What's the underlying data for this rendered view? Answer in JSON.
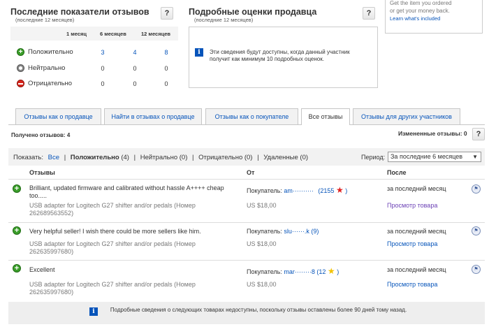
{
  "left_panel": {
    "title": "Последние показатели отзывов",
    "subtitle": "(последние 12 месяцев)",
    "help": "?",
    "columns": [
      "1 месяц",
      "6 месяцев",
      "12 месяцев"
    ],
    "rows": [
      {
        "label": "Положительно",
        "values": [
          "3",
          "4",
          "8"
        ]
      },
      {
        "label": "Нейтрально",
        "values": [
          "0",
          "0",
          "0"
        ]
      },
      {
        "label": "Отрицательно",
        "values": [
          "0",
          "0",
          "0"
        ]
      }
    ]
  },
  "mid_panel": {
    "title": "Подробные оценки продавца",
    "subtitle": "(последние 12 месяцев)",
    "help": "?",
    "info": "Эти сведения будут доступны, когда данный участник получит как минимум 10 подробных оценок.",
    "info_icon": "i"
  },
  "right_panel": {
    "line1": "Get the item you ordered",
    "line2": "or get your money back.",
    "link": "Learn what's included"
  },
  "tabs": [
    "Отзывы как о продавце",
    "Найти в отзывах о продавце",
    "Отзывы как о покупателе",
    "Все отзывы",
    "Отзывы для других участников"
  ],
  "received": "Получено отзывов: 4",
  "changed": "Измененные отзывы: 0",
  "changed_help": "?",
  "filter": {
    "show_label": "Показать:",
    "all": "Все",
    "positive": "Положительно",
    "positive_count": "(4)",
    "neutral": "Нейтрально (0)",
    "negative": "Отрицательно (0)",
    "deleted": "Удаленные (0)",
    "separator": "|",
    "period_label": "Период:",
    "period_value": "За последние 6 месяцев"
  },
  "table": {
    "col_reviews": "Отзывы",
    "col_from": "От",
    "col_when": "После",
    "rows": [
      {
        "comment": "Brilliant, updated firmware and calibrated without hassle A++++ cheap too.....",
        "item": "USB adapter for Logitech G27 shifter and/or pedals (Номер 262689563552)",
        "buyer_label": "Покупатель:",
        "buyer_name": "am··········",
        "rating_open": "(",
        "rating": "2155",
        "rating_close": ")",
        "price": "US $18,00",
        "when": "за последний месяц",
        "view": "Просмотр товара",
        "star_color": "#e02020"
      },
      {
        "comment": "Very helpful seller! I wish there could be more sellers like him.",
        "item": "USB adapter for Logitech G27 shifter and/or pedals (Номер 262635997680)",
        "buyer_label": "Покупатель:",
        "buyer_name": "slu······.k",
        "rating_open": "(",
        "rating": "9",
        "rating_close": ")",
        "price": "US $18,00",
        "when": "за последний месяц",
        "view": "Просмотр товара",
        "star_color": ""
      },
      {
        "comment": "Excellent",
        "item": "USB adapter for Logitech G27 shifter and/or pedals (Номер 262635997680)",
        "buyer_label": "Покупатель:",
        "buyer_name": "mar········8",
        "rating_open": "(",
        "rating": "12",
        "rating_close": ")",
        "price": "US $18,00",
        "when": "за последний месяц",
        "view": "Просмотр товара",
        "star_color": "#f2c200"
      }
    ]
  },
  "footer_note": "Подробные сведения о следующих товарах недоступны, поскольку отзывы оставлены более 90 дней тому назад.",
  "footer_icon": "i"
}
